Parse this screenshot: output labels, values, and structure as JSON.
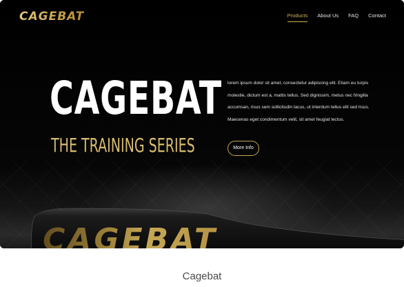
{
  "header": {
    "logo_text": "CAGEBAT",
    "nav": [
      {
        "label": "Products",
        "active": true
      },
      {
        "label": "About Us",
        "active": false
      },
      {
        "label": "FAQ",
        "active": false
      },
      {
        "label": "Contact",
        "active": false
      }
    ]
  },
  "hero": {
    "title": "CAGEBAT",
    "subtitle": "THE TRAINING SERIES",
    "description": "lorem ipsum dolor sit amet, consectetur adipiscing elit. Etiam eu turpis molestie, dictum est a, mattis tellus. Sed dignissim, metus nec fringilla accumsan, risus sem sollicitudin lacus, ut interdum tellus elit sed risus. Maecenas eget condimentum velit, sit amet feugiat lectus.",
    "button_label": "More Info",
    "bat_label": "CAGEBAT"
  },
  "caption": "Cagebat",
  "colors": {
    "accent_gold": "#d4b061",
    "background": "#0a0a0a",
    "text": "#ffffff"
  }
}
